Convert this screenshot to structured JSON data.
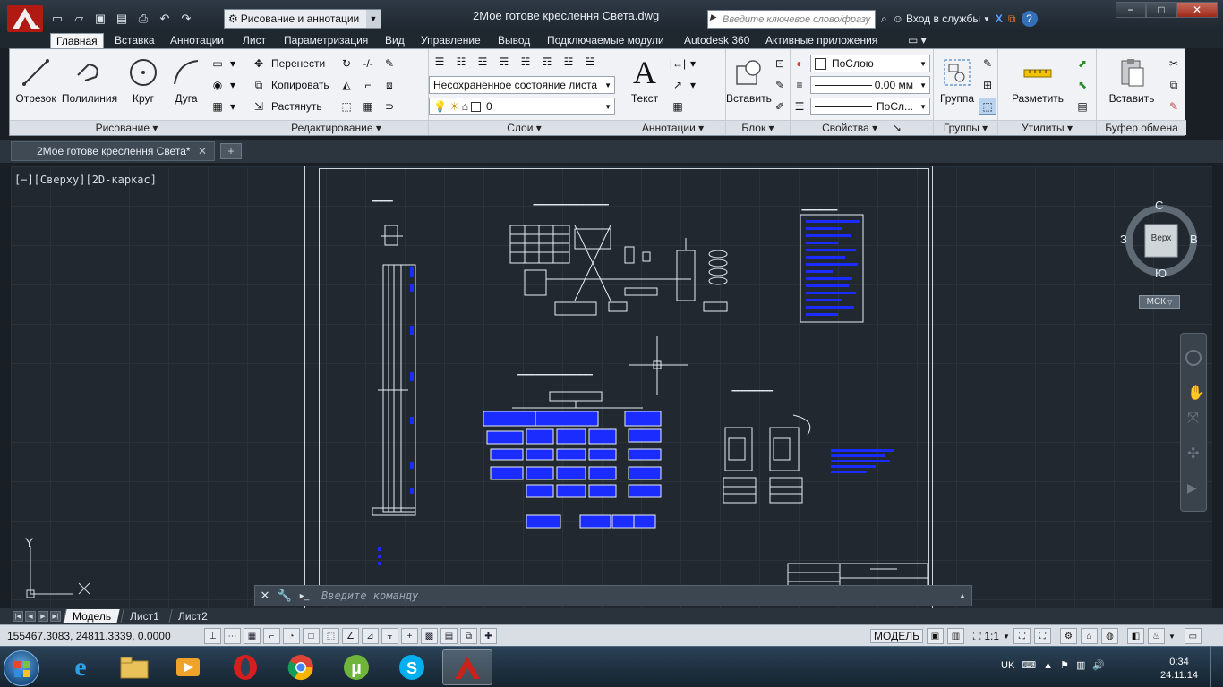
{
  "window": {
    "title": "2Мое готове креслення Света.dwg",
    "workspace": "Рисование и аннотации",
    "search_placeholder": "Введите ключевое слово/фразу",
    "signin": "Вход в службы"
  },
  "ribbon_tabs": [
    "Главная",
    "Вставка",
    "Аннотации",
    "Лист",
    "Параметризация",
    "Вид",
    "Управление",
    "Вывод",
    "Подключаемые модули",
    "Autodesk 360",
    "Активные приложения"
  ],
  "ribbon": {
    "draw": {
      "label": "Рисование",
      "line": "Отрезок",
      "polyline": "Полилиния",
      "circle": "Круг",
      "arc": "Дуга"
    },
    "modify": {
      "label": "Редактирование",
      "move": "Перенести",
      "copy": "Копировать",
      "stretch": "Растянуть"
    },
    "layers": {
      "label": "Слои",
      "state": "Несохраненное состояние листа",
      "current_layer": "0"
    },
    "annotation": {
      "label": "Аннотации",
      "text": "Текст"
    },
    "block": {
      "label": "Блок",
      "insert": "Вставить"
    },
    "properties": {
      "label": "Свойства",
      "color": "ПоСлою",
      "lineweight": "0.00 мм",
      "linetype": "ПоСл..."
    },
    "groups": {
      "label": "Группы",
      "group": "Группа"
    },
    "utilities": {
      "label": "Утилиты",
      "measure": "Разметить"
    },
    "clipboard": {
      "label": "Буфер обмена",
      "paste": "Вставить"
    }
  },
  "doc_tab": {
    "name": "2Мое готове креслення Света*"
  },
  "viewport": {
    "label": "[−][Сверху][2D-каркас]",
    "viewcube": {
      "top": "Верх",
      "north": "С",
      "south": "Ю",
      "west": "З",
      "east": "В"
    },
    "ucs_name": "МСК",
    "ucs_y": "Y"
  },
  "command": {
    "placeholder": "Введите команду"
  },
  "layout_tabs": [
    "Модель",
    "Лист1",
    "Лист2"
  ],
  "status": {
    "coords": "155467.3083, 24811.3339, 0.0000",
    "model": "МОДЕЛЬ",
    "scale": "1:1"
  },
  "tray": {
    "lang": "UK",
    "time": "0:34",
    "date": "24.11.14"
  },
  "colors": {
    "viewport_bg": "#212830",
    "accent_red": "#c8221a",
    "drawing_blue": "#1a2cff"
  }
}
